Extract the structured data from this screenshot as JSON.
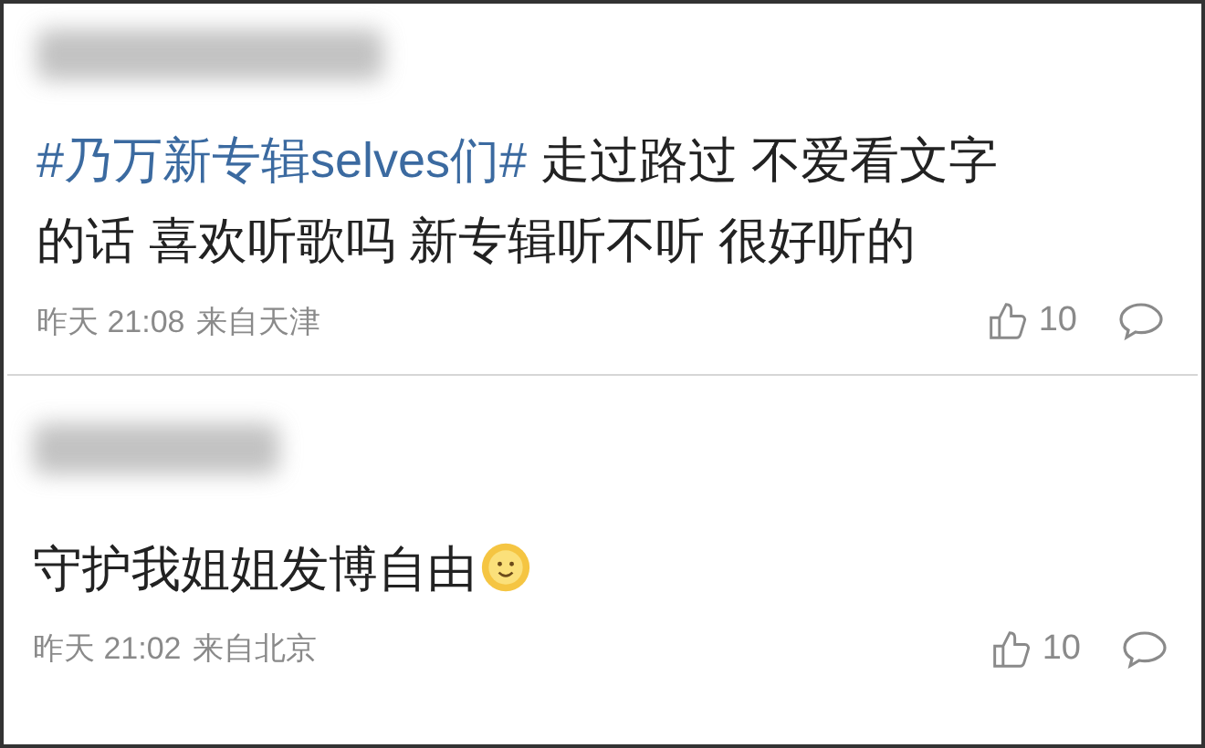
{
  "comments": [
    {
      "segments": [
        {
          "kind": "hashtag",
          "text": "#乃万新专辑selves们#"
        },
        {
          "kind": "plain",
          "text": " 走过路过 不爱看文字的话 喜欢听歌吗 新专辑听不听 很好听的"
        }
      ],
      "emoji": false,
      "time": "昨天 21:08",
      "source": "来自天津",
      "likes": "10"
    },
    {
      "segments": [
        {
          "kind": "plain",
          "text": "守护我姐姐发博自由"
        }
      ],
      "emoji": true,
      "time": "昨天 21:02",
      "source": "来自北京",
      "likes": "10"
    }
  ]
}
